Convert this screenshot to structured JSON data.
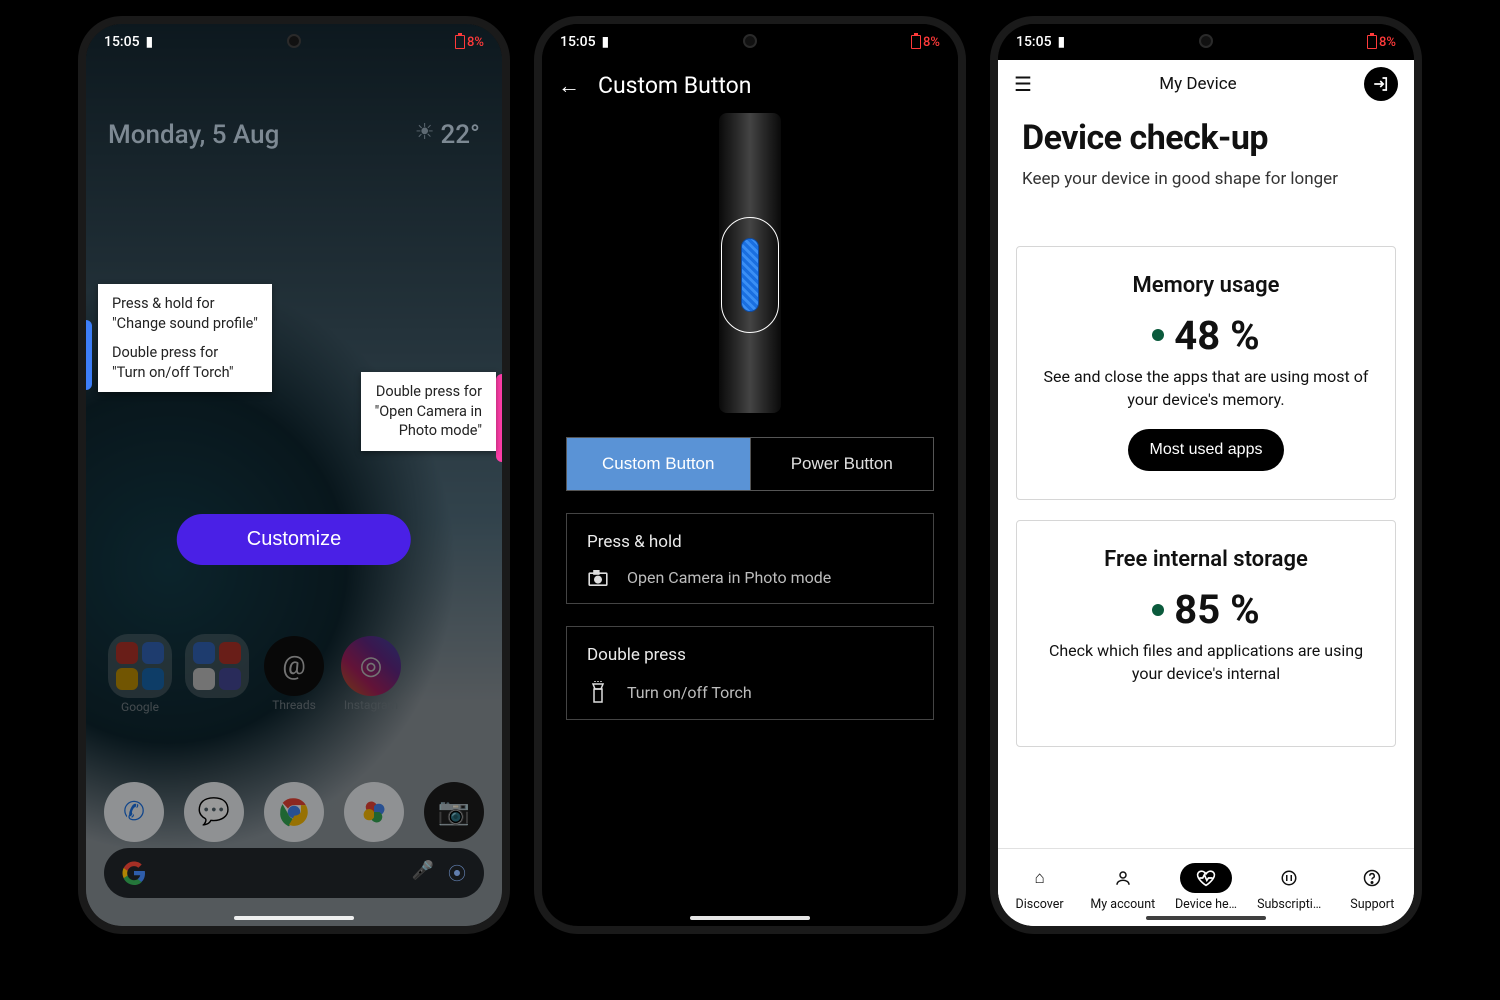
{
  "status": {
    "time": "15:05",
    "battery_pct": "8%"
  },
  "phone1": {
    "date": "Monday, 5 Aug",
    "temp": "22°",
    "note_left_l1": "Press & hold for",
    "note_left_l2": "\"Change sound profile\"",
    "note_left_l3": "Double press for",
    "note_left_l4": "\"Turn on/off Torch\"",
    "note_right_l1": "Double press for",
    "note_right_l2": "\"Open Camera in",
    "note_right_l3": "Photo mode\"",
    "customize": "Customize",
    "apps": {
      "google": "Google",
      "threads": "Threads",
      "instagram": "Instagram"
    }
  },
  "phone2": {
    "title": "Custom Button",
    "seg_custom": "Custom Button",
    "seg_power": "Power Button",
    "card1_label": "Press & hold",
    "card1_action": "Open Camera in Photo mode",
    "card2_label": "Double press",
    "card2_action": "Turn on/off Torch"
  },
  "phone3": {
    "top_title": "My Device",
    "h1": "Device check-up",
    "sub": "Keep your device in good shape for longer",
    "mem_title": "Memory usage",
    "mem_value": "48 %",
    "mem_desc": "See and close the apps that are using most of your device's memory.",
    "mem_action": "Most used apps",
    "storage_title": "Free internal storage",
    "storage_value": "85 %",
    "storage_desc": "Check which files and applications are using your device's internal",
    "tabs": {
      "discover": "Discover",
      "account": "My account",
      "health": "Device he…",
      "subs": "Subscripti…",
      "support": "Support"
    }
  }
}
